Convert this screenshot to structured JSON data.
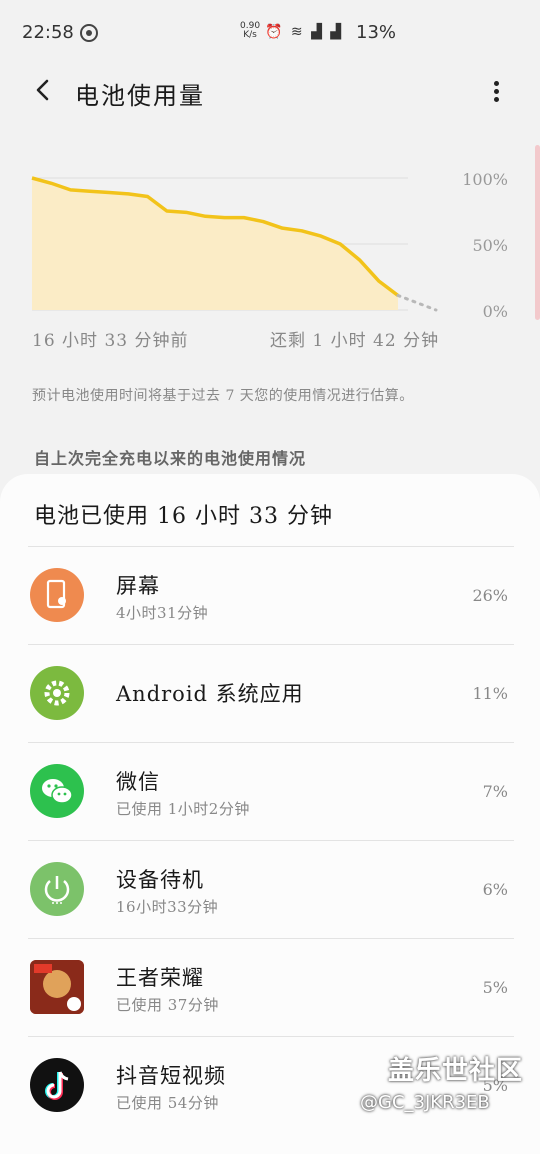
{
  "status_bar": {
    "time": "22:58",
    "speed": "0.90\nK/s",
    "battery": "13%"
  },
  "header": {
    "title": "电池使用量"
  },
  "chart_data": {
    "type": "area",
    "y_ticks": [
      "100%",
      "50%",
      "0%"
    ],
    "x_start_label": "16 小时 33 分钟前",
    "x_end_label": "还剩 1 小时 42 分钟",
    "ylim": [
      0,
      100
    ],
    "series": [
      {
        "values": [
          100,
          96,
          91,
          90,
          89,
          88,
          86,
          75,
          74,
          71,
          70,
          70,
          67,
          62,
          60,
          56,
          50,
          38,
          22,
          11
        ],
        "color": "#f2c31a"
      }
    ],
    "projection": [
      11,
      0
    ],
    "fill": "#fbecc6"
  },
  "note": "预计电池使用时间将基于过去 7 天您的使用情况进行估算。",
  "section_title": "自上次完全充电以来的电池使用情况",
  "usage": {
    "title": "电池已使用 16 小时 33 分钟",
    "apps": [
      {
        "name": "屏幕",
        "sub": "4小时31分钟",
        "pct": "26%",
        "icon": "screen-icon",
        "color": "#ef8a4f"
      },
      {
        "name": "Android 系统应用",
        "sub": "",
        "pct": "11%",
        "icon": "gear-icon",
        "color": "#7cba3f"
      },
      {
        "name": "微信",
        "sub": "已使用 1小时2分钟",
        "pct": "7%",
        "icon": "wechat-icon",
        "color": "#2dc14e"
      },
      {
        "name": "设备待机",
        "sub": "16小时33分钟",
        "pct": "6%",
        "icon": "power-icon",
        "color": "#7cc26a"
      },
      {
        "name": "王者荣耀",
        "sub": "已使用 37分钟",
        "pct": "5%",
        "icon": "game-icon",
        "color": "#c44a2a"
      },
      {
        "name": "抖音短视频",
        "sub": "已使用 54分钟",
        "pct": "5%",
        "icon": "tiktok-icon",
        "color": "#111111"
      }
    ]
  },
  "watermark": {
    "line1": "盖乐世社区",
    "line2": "@GC_3JKR3EB"
  }
}
